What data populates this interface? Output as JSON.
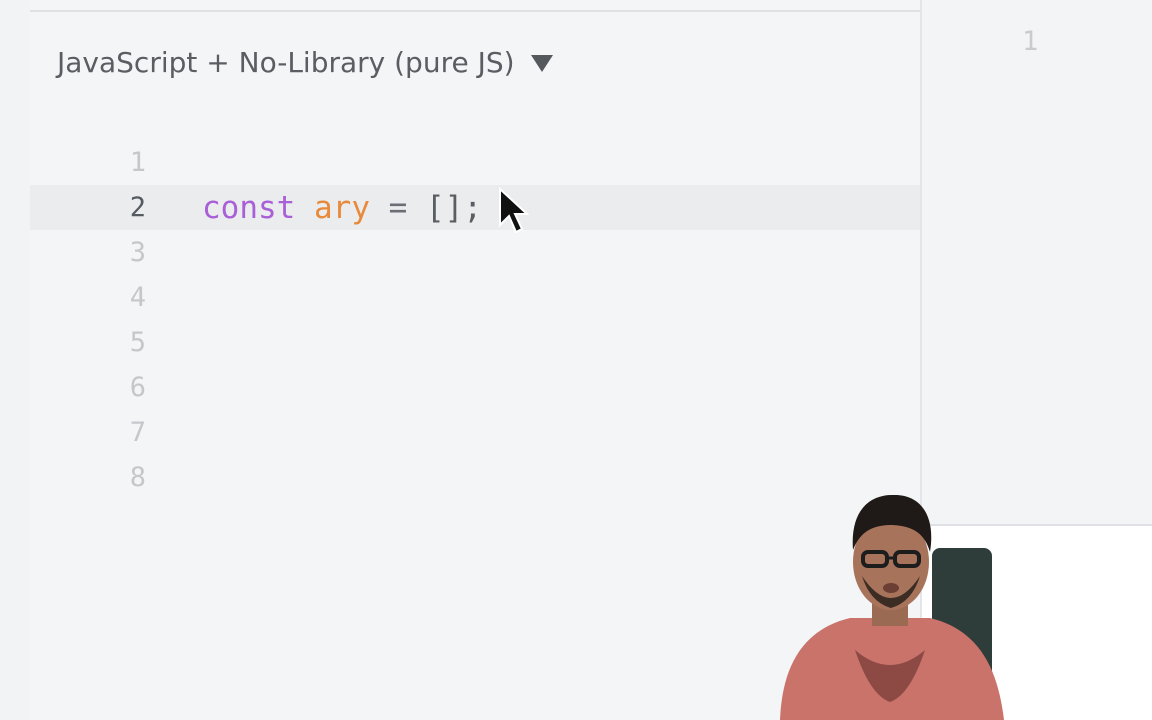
{
  "editor": {
    "language_label": "JavaScript + No-Library (pure JS)",
    "lines": [
      {
        "number": "1"
      },
      {
        "number": "2"
      },
      {
        "number": "3"
      },
      {
        "number": "4"
      },
      {
        "number": "5"
      },
      {
        "number": "6"
      },
      {
        "number": "7"
      },
      {
        "number": "8"
      }
    ],
    "code": {
      "keyword": "const",
      "variable": "ary",
      "operator": "=",
      "value": "[]",
      "terminator": ";"
    }
  },
  "output": {
    "line_number": "1"
  },
  "colors": {
    "keyword": "#a95fd7",
    "variable": "#e88a3b",
    "line_number_inactive": "#c5c7cb",
    "line_number_active": "#555a60"
  }
}
